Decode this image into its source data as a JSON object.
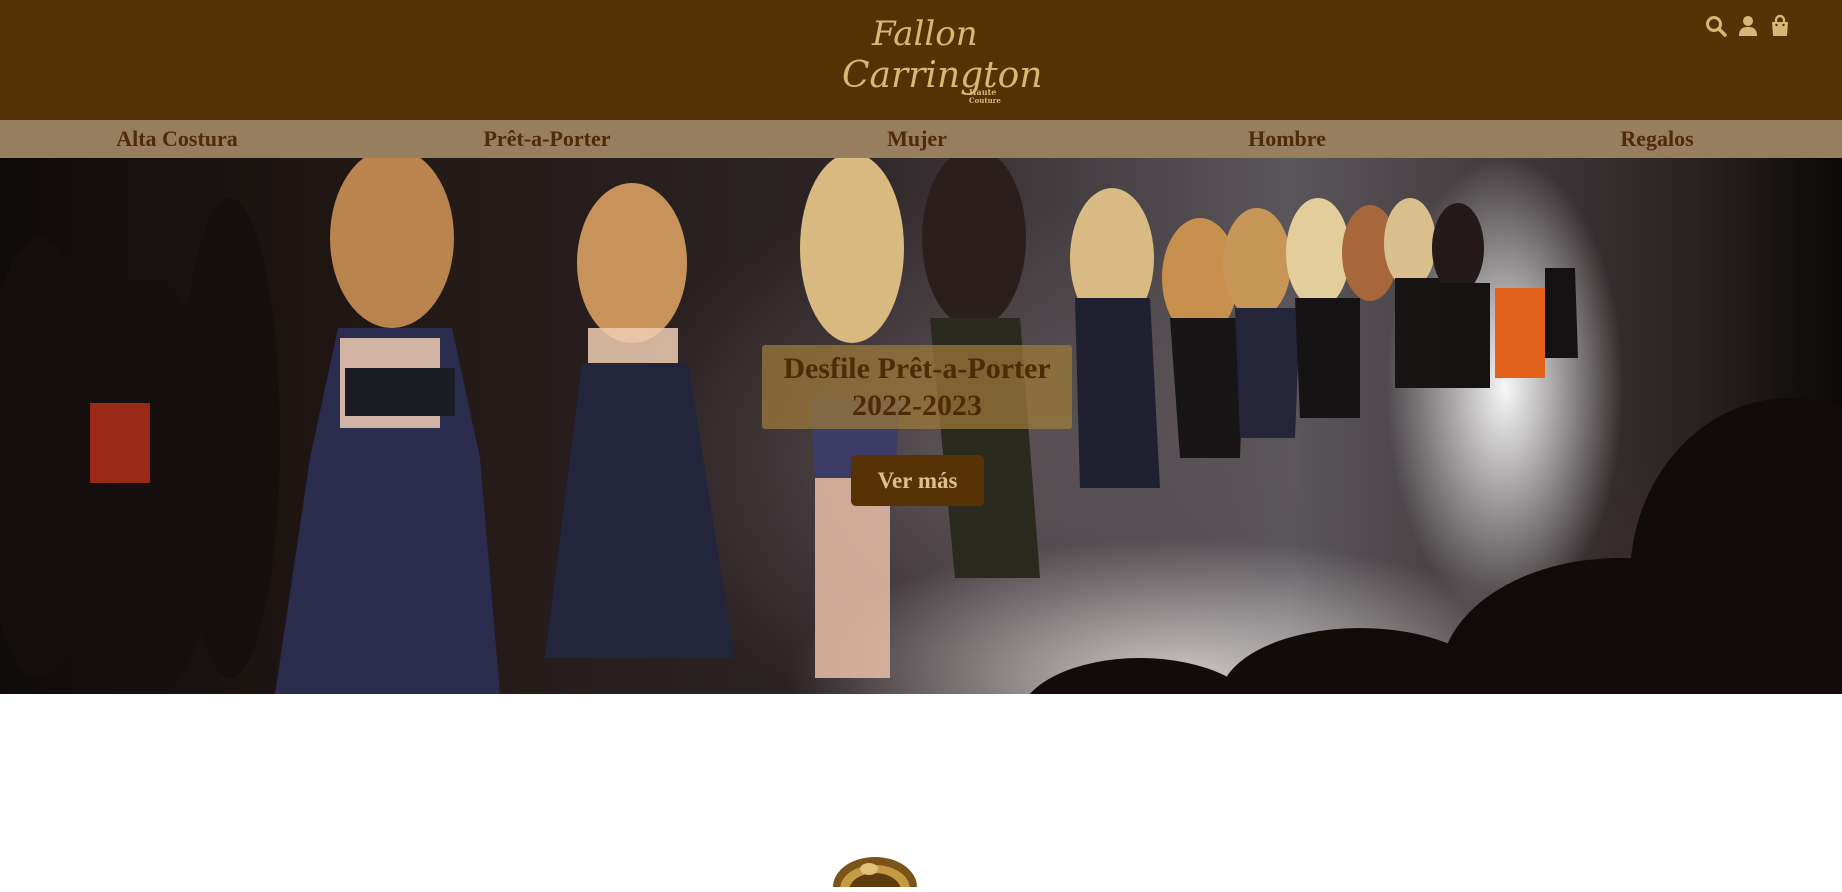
{
  "brand": {
    "line1": "Fallon",
    "line2": "Carrington",
    "tag1": "Haute",
    "tag2": "Couture"
  },
  "header_icons": [
    "search-icon",
    "user-icon",
    "shopping-bag-icon"
  ],
  "nav": {
    "items": [
      {
        "label": "Alta Costura"
      },
      {
        "label": "Prêt-a-Porter"
      },
      {
        "label": "Mujer"
      },
      {
        "label": "Hombre"
      },
      {
        "label": "Regalos"
      }
    ]
  },
  "hero": {
    "title": "Desfile Prêt-a-Porter 2022-2023",
    "button_label": "Ver más"
  },
  "colors": {
    "header_bg": "#553204",
    "nav_bg": "#967e5e",
    "nav_text": "#4e2c07",
    "gold": "#d8b776",
    "button_bg": "#573204",
    "button_text": "#dcc08a"
  }
}
